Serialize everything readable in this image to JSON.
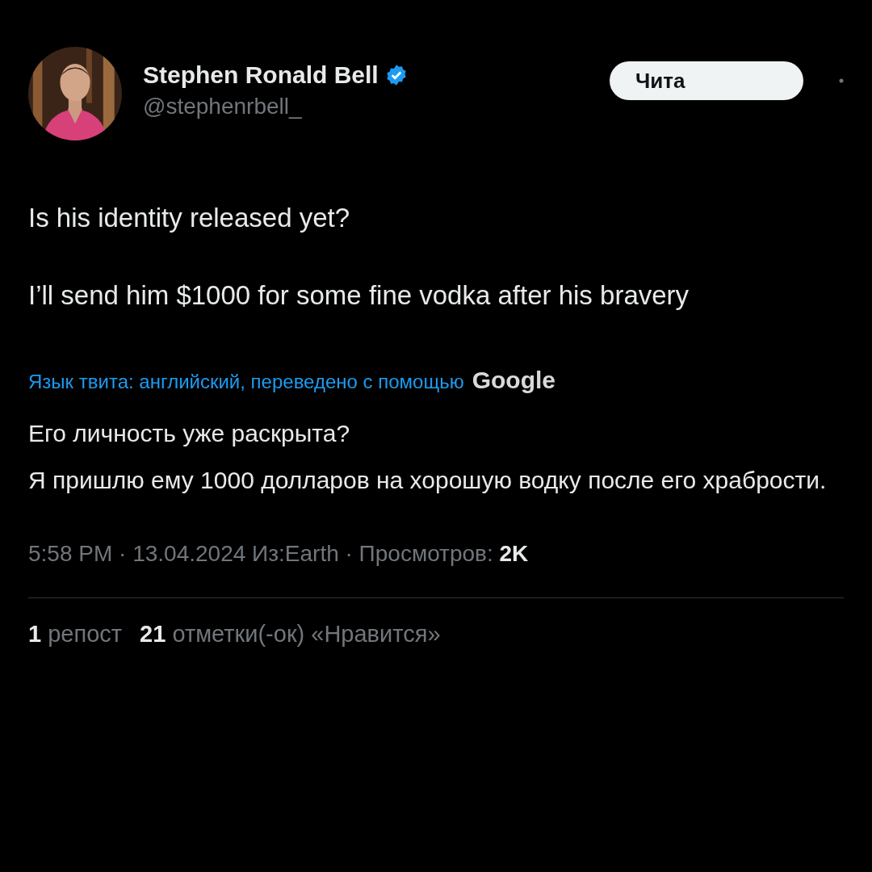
{
  "author": {
    "name": "Stephen Ronald Bell",
    "verified": true,
    "handle": "@stephenrbell_"
  },
  "follow_button": {
    "label": "Чита"
  },
  "tweet_paragraphs": [
    "Is his identity released yet?",
    "I’ll send him $1000 for some fine vodka after his bravery"
  ],
  "translation": {
    "note": "Язык твита: английский, переведено с помощью",
    "provider": "Google",
    "paragraphs": [
      "Его личность уже раскрыта?",
      "Я пришлю ему 1000 долларов на хорошую водку после его храбрости."
    ]
  },
  "meta": "5:58 PM · 13.04.2024 Из:Earth · Просмотров: **2K**",
  "stats": [
    "**1** репост",
    "**21** отметки(-ок) «Нравится»"
  ]
}
